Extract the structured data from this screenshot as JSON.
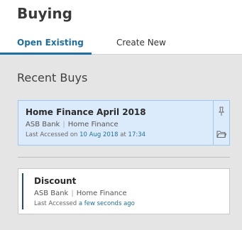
{
  "page": {
    "title": "Buying"
  },
  "tabs": [
    {
      "label": "Open Existing",
      "active": true
    },
    {
      "label": "Create New",
      "active": false
    }
  ],
  "recent": {
    "title": "Recent Buys",
    "items": [
      {
        "name": "Home Finance April 2018",
        "bank": "ASB Bank",
        "product": "Home Finance",
        "accessed_prefix": "Last Accessed on",
        "accessed_date": "10 Aug 2018",
        "accessed_at": "at",
        "accessed_time": "17:34"
      },
      {
        "name": "Discount",
        "bank": "ASB Bank",
        "product": "Home Finance",
        "accessed_prefix": "Last Accessed",
        "accessed_rel": "a few seconds ago"
      }
    ]
  },
  "icons": {
    "pin": "pin-icon",
    "folder": "folder-icon"
  },
  "colors": {
    "accent": "#1e6f9f",
    "selected_bg": "#dcebfb",
    "panel_bg": "#e5e5e5"
  }
}
